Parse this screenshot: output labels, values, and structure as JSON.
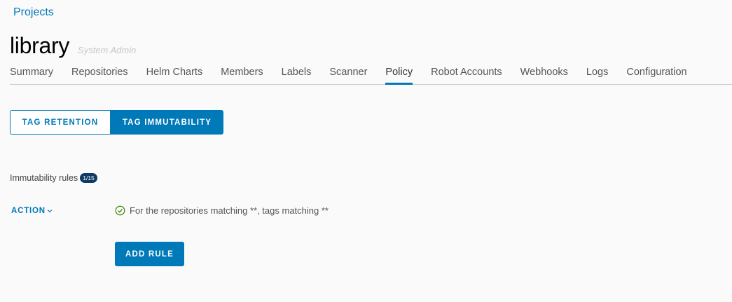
{
  "breadcrumb": {
    "projects": "Projects"
  },
  "header": {
    "title": "library",
    "role": "System Admin"
  },
  "tabs": [
    {
      "label": "Summary",
      "active": false
    },
    {
      "label": "Repositories",
      "active": false
    },
    {
      "label": "Helm Charts",
      "active": false
    },
    {
      "label": "Members",
      "active": false
    },
    {
      "label": "Labels",
      "active": false
    },
    {
      "label": "Scanner",
      "active": false
    },
    {
      "label": "Policy",
      "active": true
    },
    {
      "label": "Robot Accounts",
      "active": false
    },
    {
      "label": "Webhooks",
      "active": false
    },
    {
      "label": "Logs",
      "active": false
    },
    {
      "label": "Configuration",
      "active": false
    }
  ],
  "policy_tabs": {
    "tag_retention": "TAG RETENTION",
    "tag_immutability": "TAG IMMUTABILITY",
    "selected": "tag_immutability"
  },
  "rules": {
    "label": "Immutability rules",
    "count": "1/15",
    "action_label": "ACTION",
    "items": [
      {
        "text": "For the repositories matching **, tags matching **",
        "status": "enabled"
      }
    ],
    "add_rule_label": "ADD RULE"
  },
  "colors": {
    "accent": "#0079b8",
    "badge": "#0f3a66",
    "success": "#3c8500"
  },
  "icons": {
    "action_caret": "chevron-down-icon",
    "rule_status": "check-circle-icon"
  }
}
